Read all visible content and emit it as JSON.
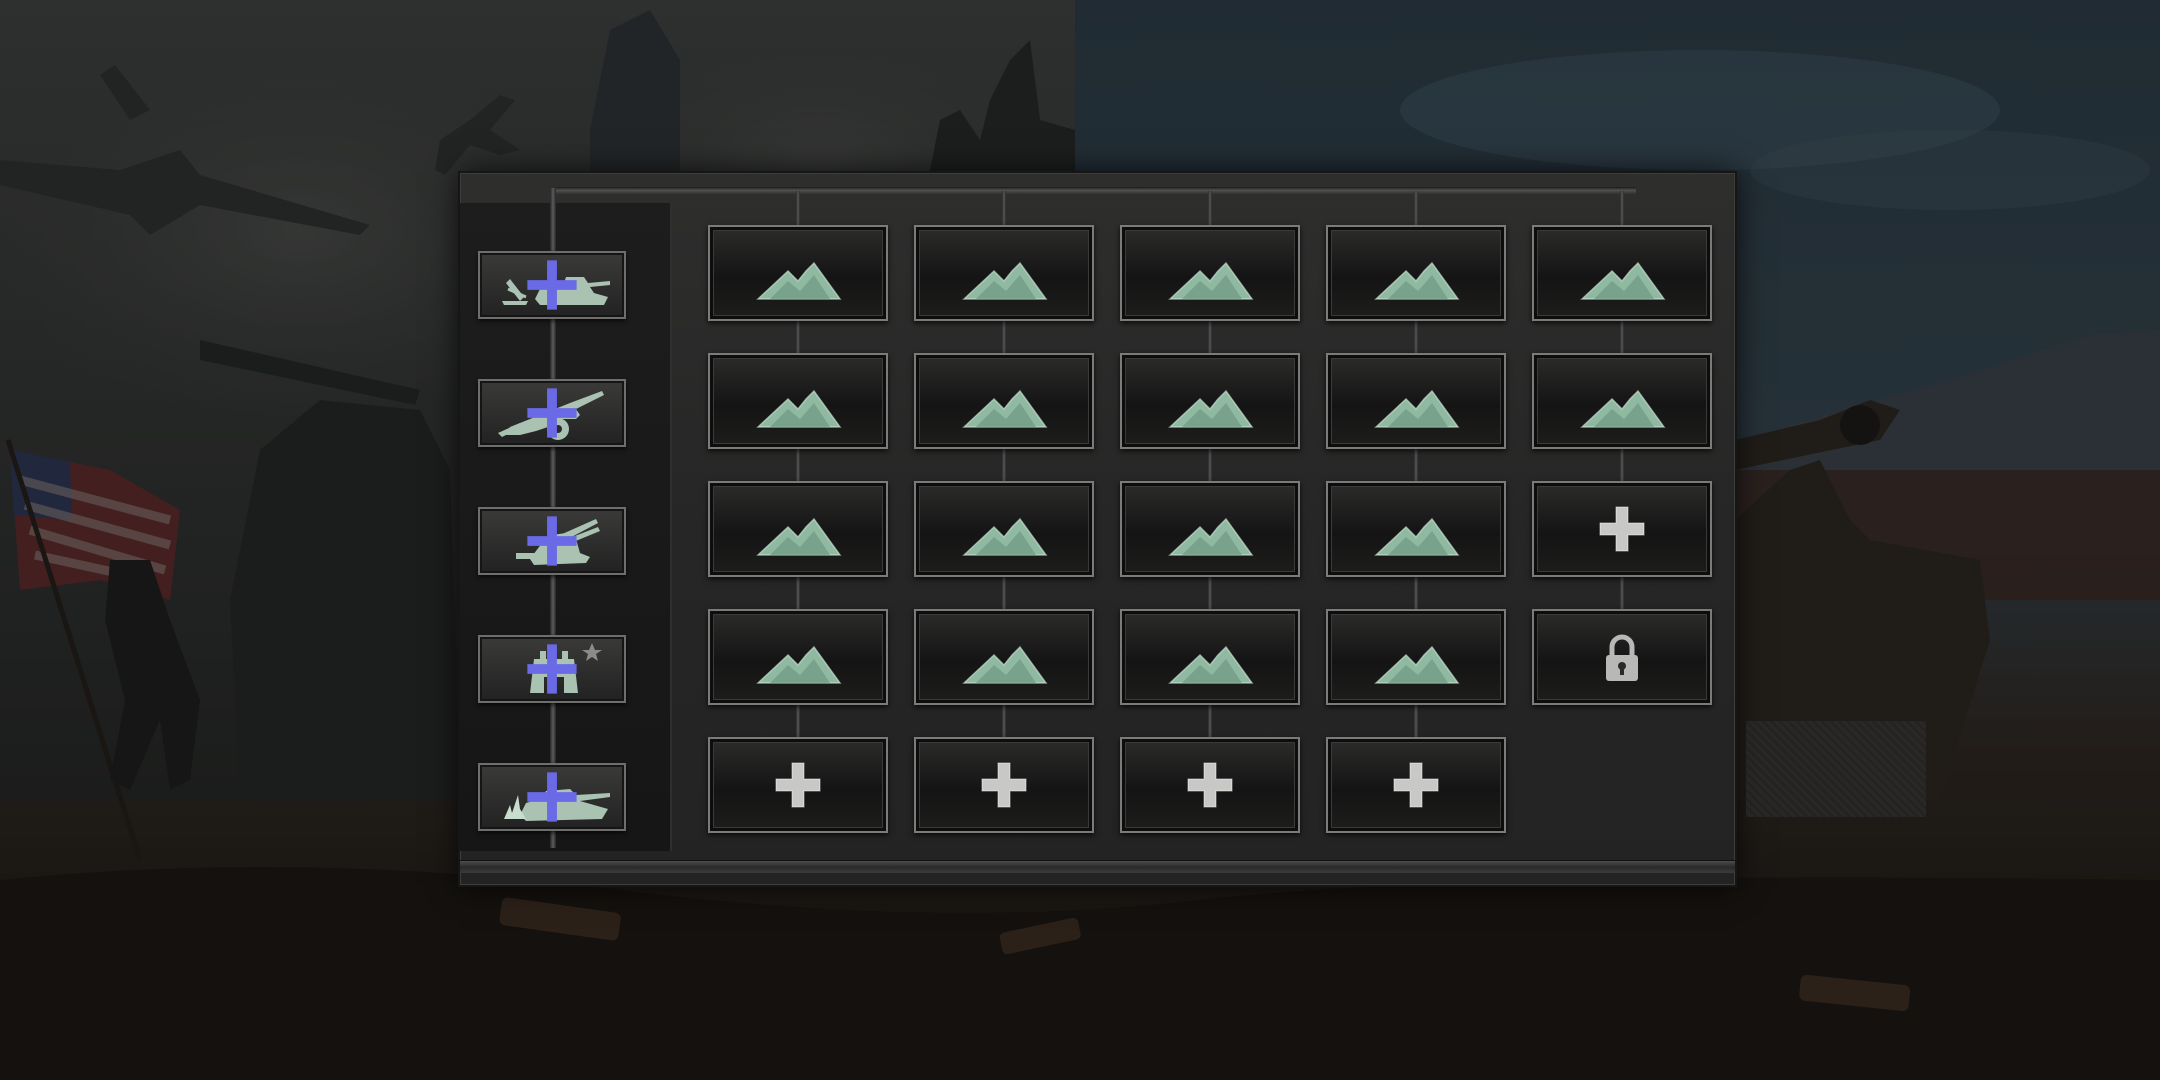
{
  "scene": {
    "background": "battlefield-artwork",
    "colors": {
      "panel": "#262626",
      "slot_border": "#7b7b79",
      "terrain_icon": "#8fb9a0",
      "plus_icon": "#c8c8c6",
      "category_plus": "#5b5bd6"
    }
  },
  "sidebar": {
    "categories": [
      {
        "id": "armor",
        "icon": "tank-with-mortar-icon",
        "badge": "blue-plus-icon"
      },
      {
        "id": "artillery",
        "icon": "field-gun-icon",
        "badge": "blue-plus-icon"
      },
      {
        "id": "anti-air",
        "icon": "anti-aircraft-gun-icon",
        "badge": "blue-plus-icon"
      },
      {
        "id": "fortification",
        "icon": "bunker-with-star-icon",
        "badge": "blue-plus-icon"
      },
      {
        "id": "flame-armor",
        "icon": "flame-tank-icon",
        "badge": "blue-plus-icon"
      }
    ]
  },
  "grid": {
    "rows": [
      {
        "slots": [
          "terrain",
          "terrain",
          "terrain",
          "terrain",
          "terrain"
        ]
      },
      {
        "slots": [
          "terrain",
          "terrain",
          "terrain",
          "terrain",
          "terrain"
        ]
      },
      {
        "slots": [
          "terrain",
          "terrain",
          "terrain",
          "terrain",
          "add"
        ]
      },
      {
        "slots": [
          "terrain",
          "terrain",
          "terrain",
          "terrain",
          "locked"
        ]
      },
      {
        "slots": [
          "add",
          "add",
          "add",
          "add",
          "empty"
        ]
      }
    ],
    "slot_icons": {
      "terrain": "mountain-terrain-icon",
      "add": "plus-icon",
      "locked": "padlock-icon"
    }
  }
}
